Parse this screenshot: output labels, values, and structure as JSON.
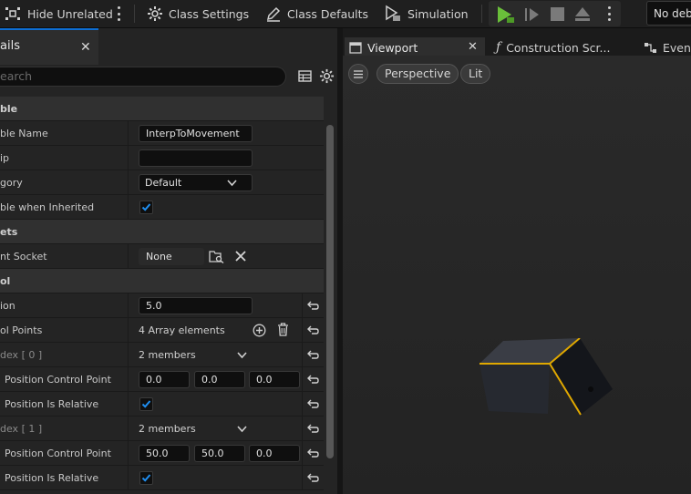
{
  "toolbar": {
    "hide_unrelated": "Hide Unrelated",
    "class_settings": "Class Settings",
    "class_defaults": "Class Defaults",
    "simulation": "Simulation",
    "debug_filter": "No debug"
  },
  "details": {
    "tab_title": "ails",
    "search_placeholder": "earch"
  },
  "rows": [
    {
      "kind": "section",
      "label": "ble"
    },
    {
      "kind": "text",
      "label": "ble Name",
      "value": "InterpToMovement"
    },
    {
      "kind": "text",
      "label": "ip",
      "value": ""
    },
    {
      "kind": "dropdown",
      "label": "gory",
      "value": "Default"
    },
    {
      "kind": "check",
      "label": "ble when Inherited",
      "checked": true
    },
    {
      "kind": "section",
      "label": "ets"
    },
    {
      "kind": "socket",
      "label": "nt Socket",
      "value": "None"
    },
    {
      "kind": "section",
      "label": "ol"
    },
    {
      "kind": "text",
      "label": "ion",
      "value": "5.0",
      "reset": true
    },
    {
      "kind": "array",
      "label": "ol Points",
      "value": "4 Array elements",
      "reset": true
    },
    {
      "kind": "members",
      "label": "dex [ 0 ]",
      "value": "2 members",
      "reset": true
    },
    {
      "kind": "vec",
      "label": "Position Control Point",
      "values": [
        "0.0",
        "0.0",
        "0.0"
      ],
      "reset": true
    },
    {
      "kind": "check",
      "label": "Position Is Relative",
      "checked": true,
      "reset": true
    },
    {
      "kind": "members",
      "label": "dex [ 1 ]",
      "value": "2 members",
      "reset": true
    },
    {
      "kind": "vec",
      "label": "Position Control Point",
      "values": [
        "50.0",
        "50.0",
        "0.0"
      ],
      "reset": true
    },
    {
      "kind": "check",
      "label": "Position Is Relative",
      "checked": true,
      "reset": true
    }
  ],
  "viewport": {
    "tab_viewport": "Viewport",
    "tab_construction": "Construction Scr...",
    "tab_event": "Event",
    "perspective": "Perspective",
    "lit": "Lit"
  },
  "colors": {
    "accent_blue": "#0e6ed3",
    "play_green": "#6abf3a",
    "cube_edge": "#e0a800"
  }
}
